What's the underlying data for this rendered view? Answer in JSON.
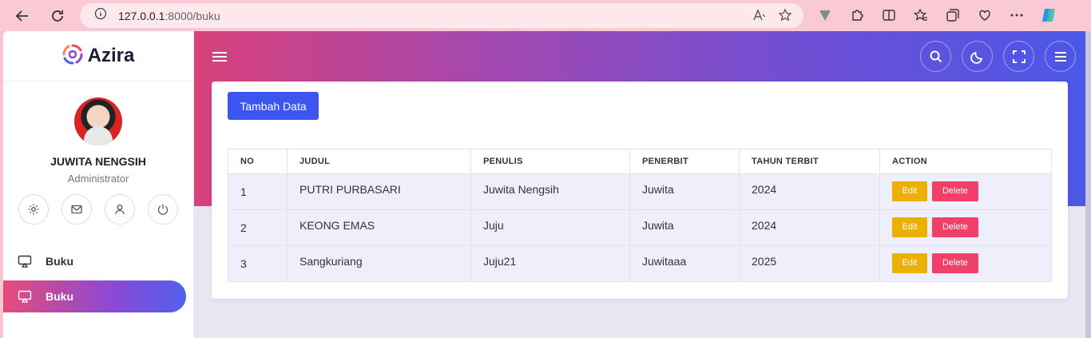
{
  "browser": {
    "url_host": "127.0.0.1",
    "url_path": ":8000/buku"
  },
  "app": {
    "logo": "Azira"
  },
  "profile": {
    "name": "JUWITA NENGSIH",
    "role": "Administrator"
  },
  "sidebar": {
    "items": [
      {
        "label": "Buku"
      },
      {
        "label": "Buku"
      }
    ]
  },
  "main": {
    "add_button": "Tambah Data",
    "table": {
      "headers": [
        "NO",
        "JUDUL",
        "PENULIS",
        "PENERBIT",
        "TAHUN TERBIT",
        "ACTION"
      ],
      "rows": [
        {
          "no": "1",
          "judul": "PUTRI PURBASARI",
          "penulis": "Juwita Nengsih",
          "penerbit": "Juwita",
          "tahun": "2024"
        },
        {
          "no": "2",
          "judul": "KEONG EMAS",
          "penulis": "Juju",
          "penerbit": "Juwita",
          "tahun": "2024"
        },
        {
          "no": "3",
          "judul": "Sangkuriang",
          "penulis": "Juju21",
          "penerbit": "Juwitaaa",
          "tahun": "2025"
        }
      ],
      "edit_label": "Edit",
      "delete_label": "Delete"
    }
  },
  "colors": {
    "accent": "#3d55f0",
    "edit": "#ebb000",
    "delete": "#f0406a"
  }
}
